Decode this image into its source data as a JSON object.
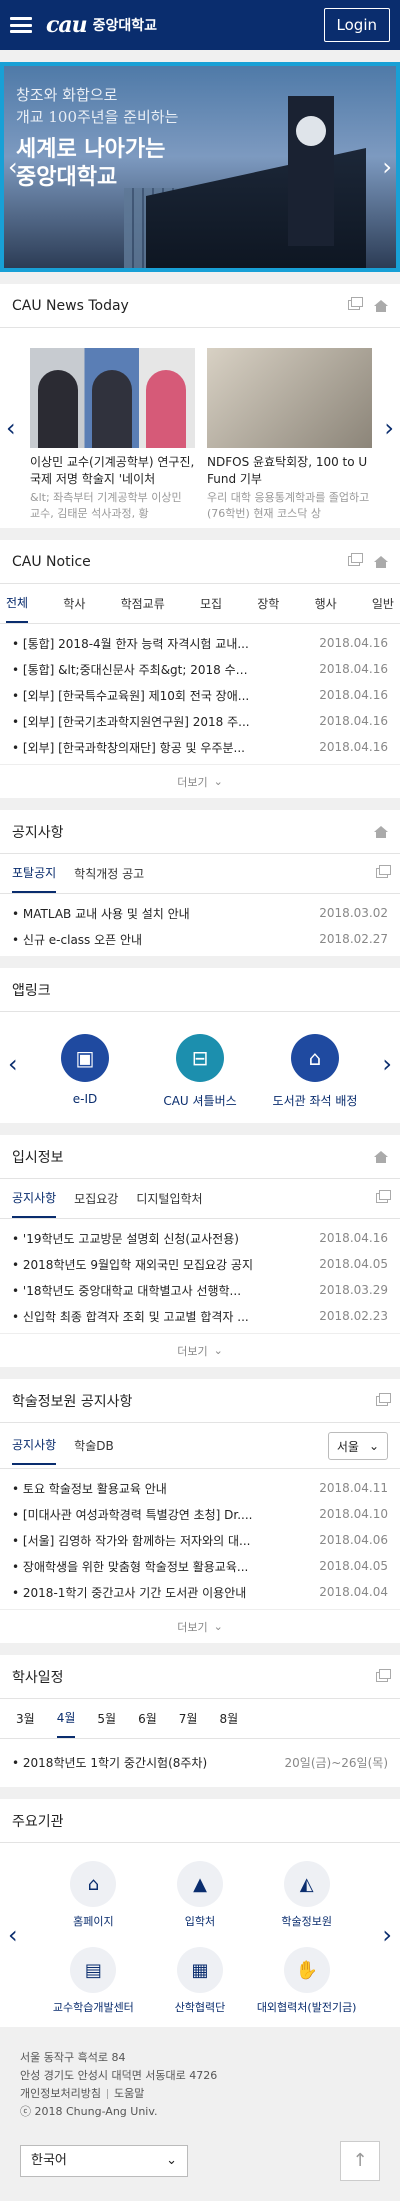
{
  "header": {
    "logo_mark": "cau",
    "logo_text": "중앙대학교",
    "login": "Login"
  },
  "banner": {
    "line1": "창조와 화합으로",
    "line2": "개교 100주년을 준비하는",
    "line3": "세계로 나아가는",
    "line4": "중앙대학교"
  },
  "news": {
    "title": "CAU News Today",
    "items": [
      {
        "title": "이상민 교수(기계공학부) 연구진, 국제 저명 학술지 '네이처",
        "sub": "&lt; 좌측부터 기계공학부 이상민 교수, 김태문 석사과정, 황"
      },
      {
        "title": "NDFOS 윤효탁회장, 100 to U Fund 기부",
        "sub": "우리 대학 응용통계학과를 졸업하고(76학번) 현재 코스닥 상"
      }
    ]
  },
  "notice": {
    "title": "CAU Notice",
    "tabs": [
      "전체",
      "학사",
      "학점교류",
      "모집",
      "장학",
      "행사",
      "일반"
    ],
    "rows": [
      {
        "t": "[통합] 2018-4월 한자 능력 자격시험 교내...",
        "d": "2018.04.16"
      },
      {
        "t": "[통합] &lt;중대신문사 주최&gt; 2018 수필 ...",
        "d": "2018.04.16"
      },
      {
        "t": "[외부] [한국특수교육원] 제10회 전국 장애...",
        "d": "2018.04.16"
      },
      {
        "t": "[외부] [한국기초과학지원연구원] 2018 주...",
        "d": "2018.04.16"
      },
      {
        "t": "[외부] [한국과학창의재단] 항공 및 우주분...",
        "d": "2018.04.16"
      }
    ],
    "more": "더보기"
  },
  "gongji": {
    "title": "공지사항",
    "tabs": [
      "포탈공지",
      "학칙개정 공고"
    ],
    "rows": [
      {
        "t": "MATLAB 교내 사용 및 설치 안내",
        "d": "2018.03.02"
      },
      {
        "t": "신규 e-class 오픈 안내",
        "d": "2018.02.27"
      }
    ]
  },
  "apps": {
    "title": "앱링크",
    "items": [
      {
        "label": "e-ID",
        "color": "#1f4aa0"
      },
      {
        "label": "CAU 셔틀버스",
        "color": "#1c8fae"
      },
      {
        "label": "도서관 좌석 배정",
        "color": "#1f4aa0"
      }
    ]
  },
  "admission": {
    "title": "입시정보",
    "tabs": [
      "공지사항",
      "모집요강",
      "디지털입학처"
    ],
    "rows": [
      {
        "t": "'19학년도 고교방문 설명회 신청(교사전용)",
        "d": "2018.04.16"
      },
      {
        "t": "2018학년도 9월입학 재외국민 모집요강 공지",
        "d": "2018.04.05"
      },
      {
        "t": "'18학년도 중앙대학교 대학별고사 선행학...",
        "d": "2018.03.29"
      },
      {
        "t": "신입학 최종 합격자 조회 및 고교별 합격자 ...",
        "d": "2018.02.23"
      }
    ],
    "more": "더보기"
  },
  "library": {
    "title": "학술정보원 공지사항",
    "tabs": [
      "공지사항",
      "학술DB"
    ],
    "select": "서울",
    "rows": [
      {
        "t": "토요 학술정보 활용교육 안내",
        "d": "2018.04.11"
      },
      {
        "t": "[미대사관 여성과학경력 특별강연 초청] Dr....",
        "d": "2018.04.10"
      },
      {
        "t": "[서울] 김영하 작가와 함께하는 저자와의 대...",
        "d": "2018.04.06"
      },
      {
        "t": "장애학생을 위한 맞춤형 학술정보 활용교육...",
        "d": "2018.04.05"
      },
      {
        "t": "2018-1학기 중간고사 기간 도서관 이용안내",
        "d": "2018.04.04"
      }
    ],
    "more": "더보기"
  },
  "schedule": {
    "title": "학사일정",
    "months": [
      "3월",
      "4월",
      "5월",
      "6월",
      "7월",
      "8월"
    ],
    "row": {
      "t": "2018학년도 1학기 중간시험(8주차)",
      "d": "20일(금)~26일(목)"
    }
  },
  "orgs": {
    "title": "주요기관",
    "items": [
      {
        "label": "홈페이지",
        "icon": "home-icon"
      },
      {
        "label": "입학처",
        "icon": "graduation-icon"
      },
      {
        "label": "학술정보원",
        "icon": "lamp-icon"
      },
      {
        "label": "교수학습개발센터",
        "icon": "teacher-icon"
      },
      {
        "label": "산학협력단",
        "icon": "building-icon"
      },
      {
        "label": "대외협력처(발전기금)",
        "icon": "handshake-icon"
      }
    ]
  },
  "footer": {
    "seoul": "서울  동작구 흑석로 84",
    "anseong": "안성  경기도 안성시 대덕면 서동대로 4726",
    "privacy": "개인정보처리방침",
    "help": "도움말",
    "copyright": "ⓒ 2018 Chung-Ang Univ.",
    "language": "한국어"
  }
}
